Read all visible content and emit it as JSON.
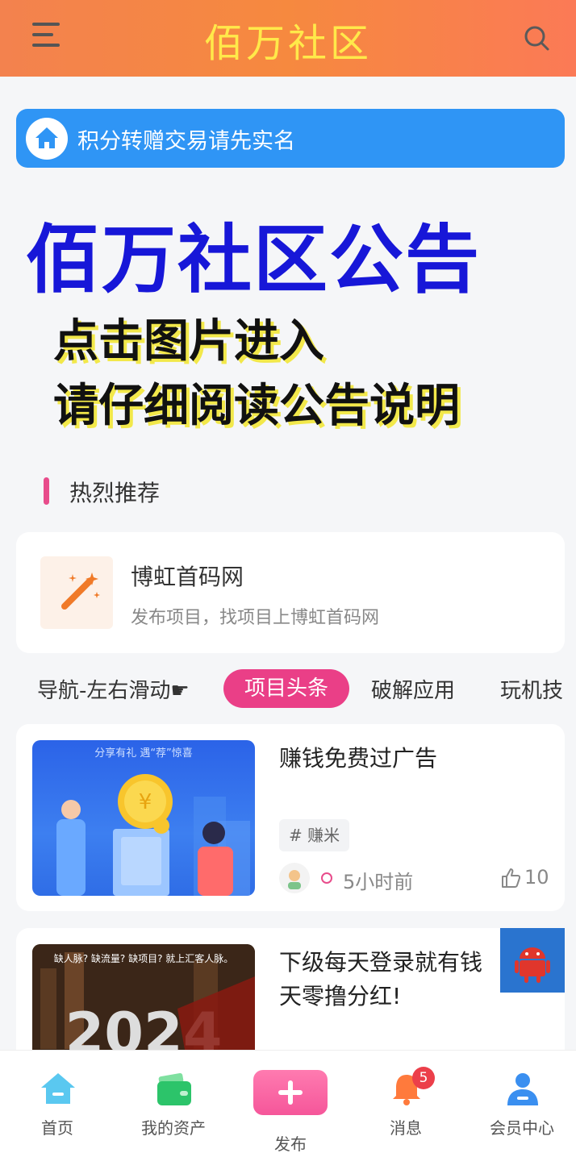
{
  "header": {
    "title": "佰万社区",
    "menu_icon": "menu-icon",
    "search_icon": "search-icon"
  },
  "notice": {
    "text": "积分转赠交易请先实名",
    "icon": "home-icon",
    "color": "#2f95f5"
  },
  "banner": {
    "title": "佰万社区公告",
    "line1": "点击图片进入",
    "line2": "请仔细阅读公告说明",
    "title_color": "#1717d8"
  },
  "section": {
    "title": "热烈推荐"
  },
  "recommend": {
    "title": "博虹首码网",
    "desc": "发布项目，找项目上博虹首码网",
    "icon": "magic-wand-icon"
  },
  "tabs": {
    "items": [
      "导航-左右滑动☛",
      "项目头条",
      "破解应用",
      "玩机技"
    ],
    "active": "项目头条",
    "active_color": "#ea3f87"
  },
  "articles": [
    {
      "title": "赚钱免费过广告",
      "image_text": "分享有礼 遇“荐”惊喜",
      "tag": "# 赚米",
      "time": "5小时前",
      "likes": "10"
    },
    {
      "title": "下级每天登录就有钱天零撸分红!",
      "image_text": "缺人脉? 缺流量? 缺项目? 就上汇客人脉。",
      "image_year": "2024"
    }
  ],
  "floating": {
    "icon": "android-icon"
  },
  "bottom_nav": {
    "items": [
      "首页",
      "我的资产",
      "发布",
      "消息",
      "会员中心"
    ],
    "message_badge": "5"
  }
}
